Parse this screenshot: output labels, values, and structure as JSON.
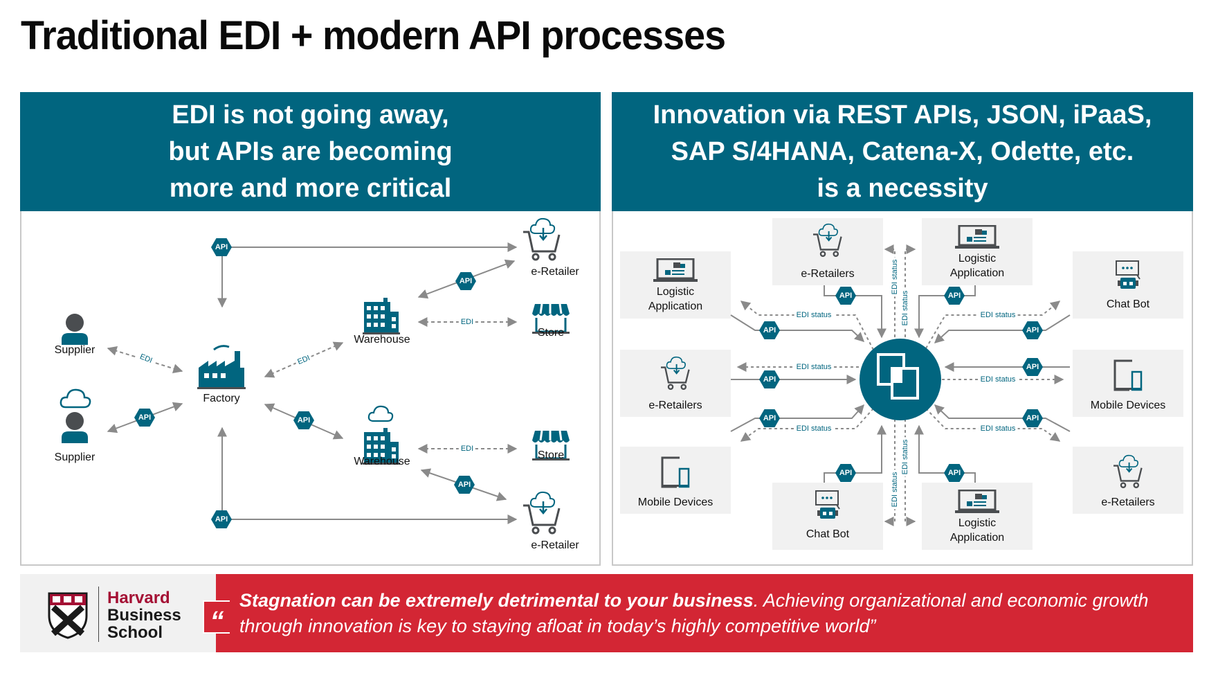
{
  "title": "Traditional EDI + modern API processes",
  "left_panel": {
    "header_lines": [
      "EDI is not going away,",
      "but APIs are becoming",
      "more and more critical"
    ],
    "nodes": {
      "supplier_1": "Supplier",
      "supplier_2": "Supplier",
      "factory": "Factory",
      "warehouse_1": "Warehouse",
      "warehouse_2": "Warehouse",
      "eretailer_1": "e-Retailer",
      "eretailer_2": "e-Retailer",
      "store_1": "Store",
      "store_2": "Store"
    },
    "api_label": "API",
    "edi_label": "EDI",
    "connections": [
      {
        "from": "Factory",
        "to": "e-Retailer (top)",
        "type": "API"
      },
      {
        "from": "Factory",
        "to": "e-Retailer (bottom)",
        "type": "API"
      },
      {
        "from": "Supplier",
        "to": "Factory",
        "type": "EDI"
      },
      {
        "from": "Supplier (cloud)",
        "to": "Factory",
        "type": "API"
      },
      {
        "from": "Factory",
        "to": "Warehouse (top)",
        "type": "EDI"
      },
      {
        "from": "Factory",
        "to": "Warehouse (cloud)",
        "type": "API"
      },
      {
        "from": "Warehouse (top)",
        "to": "e-Retailer (top)",
        "type": "API"
      },
      {
        "from": "Warehouse (top)",
        "to": "Store (top)",
        "type": "EDI"
      },
      {
        "from": "Warehouse (cloud)",
        "to": "Store (bottom)",
        "type": "EDI"
      },
      {
        "from": "Warehouse (cloud)",
        "to": "e-Retailer (bottom)",
        "type": "API"
      }
    ]
  },
  "right_panel": {
    "header_lines": [
      "Innovation via REST APIs, JSON, iPaaS,",
      "SAP S/4HANA, Catena-X, Odette, etc.",
      "is a necessity"
    ],
    "hub_icon": "integration-hub-icon",
    "api_label": "API",
    "edi_status_label": "EDI status",
    "tiles": {
      "top_left_1": {
        "label_lines": [
          "e-Retailers"
        ],
        "icon": "cloud-cart-icon"
      },
      "top_right_1": {
        "label_lines": [
          "Logistic",
          "Application"
        ],
        "icon": "logistic-laptop-icon"
      },
      "left_1": {
        "label_lines": [
          "Logistic",
          "Application"
        ],
        "icon": "logistic-laptop-icon"
      },
      "left_2": {
        "label_lines": [
          "e-Retailers"
        ],
        "icon": "cloud-cart-icon"
      },
      "left_3": {
        "label_lines": [
          "Mobile Devices"
        ],
        "icon": "mobile-devices-icon"
      },
      "right_1": {
        "label_lines": [
          "Chat Bot"
        ],
        "icon": "chat-bot-icon"
      },
      "right_2": {
        "label_lines": [
          "Mobile Devices"
        ],
        "icon": "mobile-devices-icon"
      },
      "right_3": {
        "label_lines": [
          "e-Retailers"
        ],
        "icon": "cloud-cart-icon"
      },
      "bottom_left_1": {
        "label_lines": [
          "Chat Bot"
        ],
        "icon": "chat-bot-icon"
      },
      "bottom_right_1": {
        "label_lines": [
          "Logistic",
          "Application"
        ],
        "icon": "logistic-laptop-icon"
      }
    }
  },
  "footer": {
    "logo": {
      "line1": "Harvard",
      "line2": "Business",
      "line3": "School"
    },
    "quote_mark": "“",
    "quote_bold": "Stagnation can be extremely detrimental to your business",
    "quote_rest": ". Achieving organizational and economic growth through innovation is key to staying afloat in today’s highly competitive world”"
  },
  "colors": {
    "teal": "#01657f",
    "red": "#d32634",
    "harvard_crimson": "#a41034",
    "tile_gray": "#f1f1f1",
    "arrow_gray": "#8a8a8a",
    "icon_dark": "#4a4d50"
  }
}
